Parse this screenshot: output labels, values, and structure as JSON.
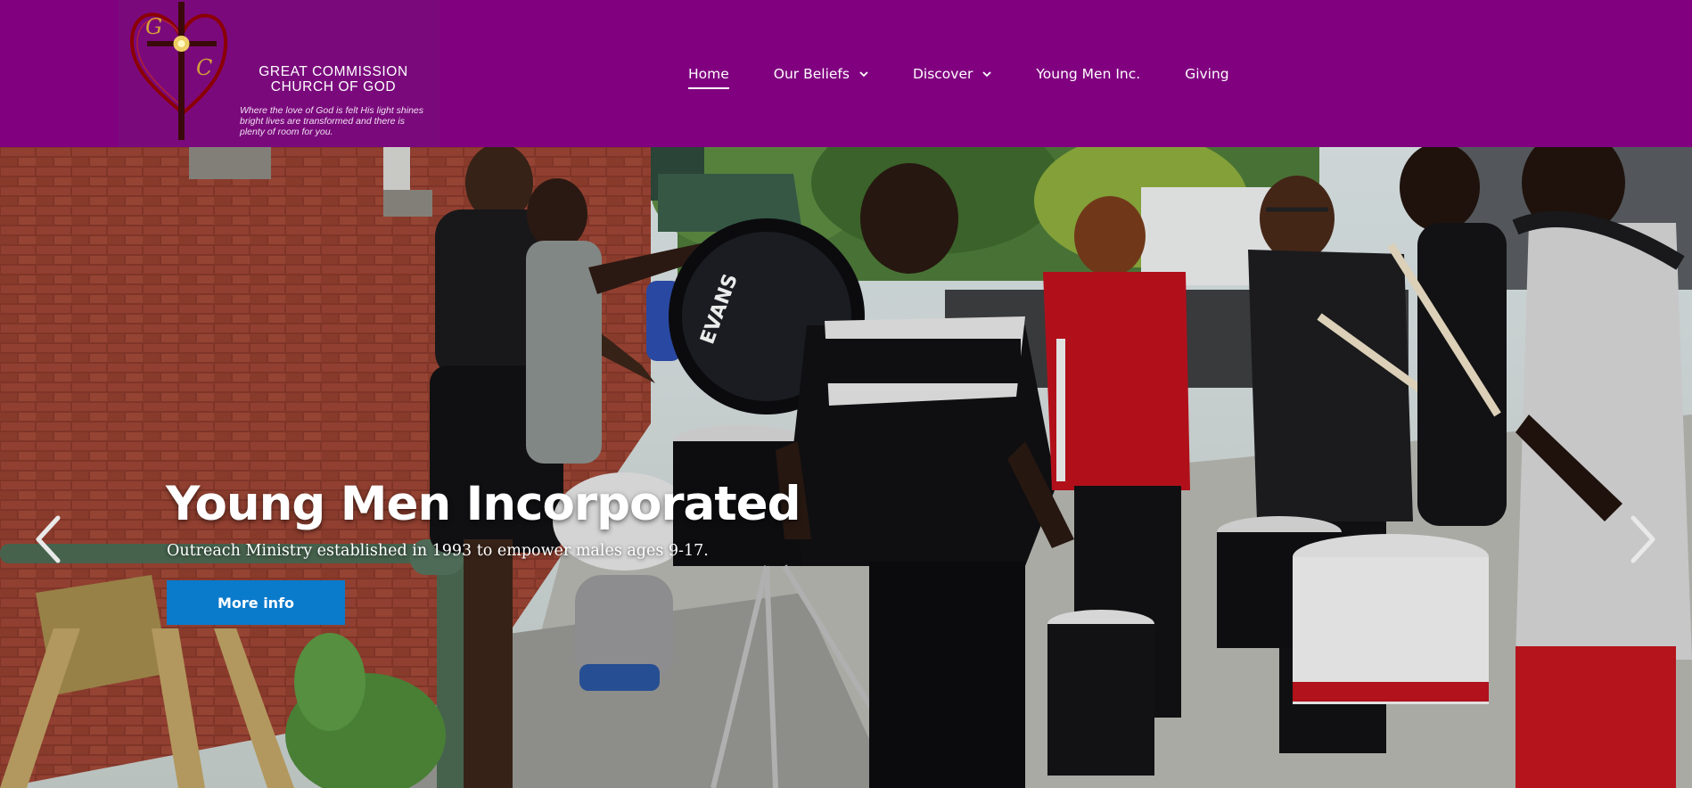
{
  "logo": {
    "initials_top": "G",
    "initials_bottom": "C",
    "name_line1": "GREAT COMMISSION",
    "name_line2": "CHURCH OF GOD",
    "tagline": "Where the love of God is felt His light shines bright lives are transformed and there is plenty of room for you."
  },
  "nav": {
    "items": [
      {
        "label": "Home",
        "active": true
      },
      {
        "label": "Our Beliefs",
        "dropdown": true
      },
      {
        "label": "Discover",
        "dropdown": true
      },
      {
        "label": "Young Men Inc."
      },
      {
        "label": "Giving"
      }
    ]
  },
  "hero": {
    "title": "Young Men Incorporated",
    "subtitle": "Outreach Ministry established in 1993 to empower males ages 9-17.",
    "button_label": "More info",
    "drum_brand": "EVANS"
  },
  "colors": {
    "header_bg": "#800080",
    "button_bg": "#0a7acb",
    "text": "#ffffff"
  }
}
